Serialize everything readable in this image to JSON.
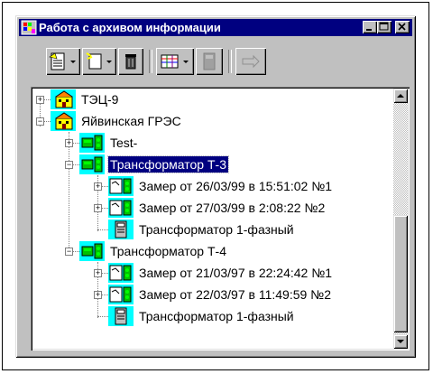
{
  "window": {
    "title": "Работа с архивом информации"
  },
  "toolbar": {
    "buttons": [
      "new-document",
      "new-item",
      "delete",
      "table-view",
      "calculator",
      "export"
    ]
  },
  "tree": {
    "nodes": [
      {
        "label": "ТЭЦ-9",
        "icon": "power-plant-icon",
        "expander": "+"
      },
      {
        "label": "Яйвинская ГРЭС",
        "icon": "power-plant-icon",
        "expander": "−"
      },
      {
        "label": "Test-",
        "icon": "device-group-icon",
        "expander": "+"
      },
      {
        "label": "Трансформатор Т-3",
        "icon": "device-group-icon",
        "expander": "−",
        "selected": true
      },
      {
        "label": "Замер от 26/03/99 в 15:51:02 №1",
        "icon": "measurement-icon",
        "expander": "+"
      },
      {
        "label": "Замер от 27/03/99 в 2:08:22 №2",
        "icon": "measurement-icon",
        "expander": "+"
      },
      {
        "label": "Трансформатор 1-фазный",
        "icon": "transformer-doc-icon"
      },
      {
        "label": "Трансформатор Т-4",
        "icon": "device-group-icon",
        "expander": "−"
      },
      {
        "label": "Замер от 21/03/97 в 22:24:42 №1",
        "icon": "measurement-icon",
        "expander": "+"
      },
      {
        "label": "Замер от 22/03/97 в 11:49:59 №2",
        "icon": "measurement-icon",
        "expander": "+"
      },
      {
        "label": "Трансформатор 1-фазный",
        "icon": "transformer-doc-icon"
      }
    ]
  }
}
